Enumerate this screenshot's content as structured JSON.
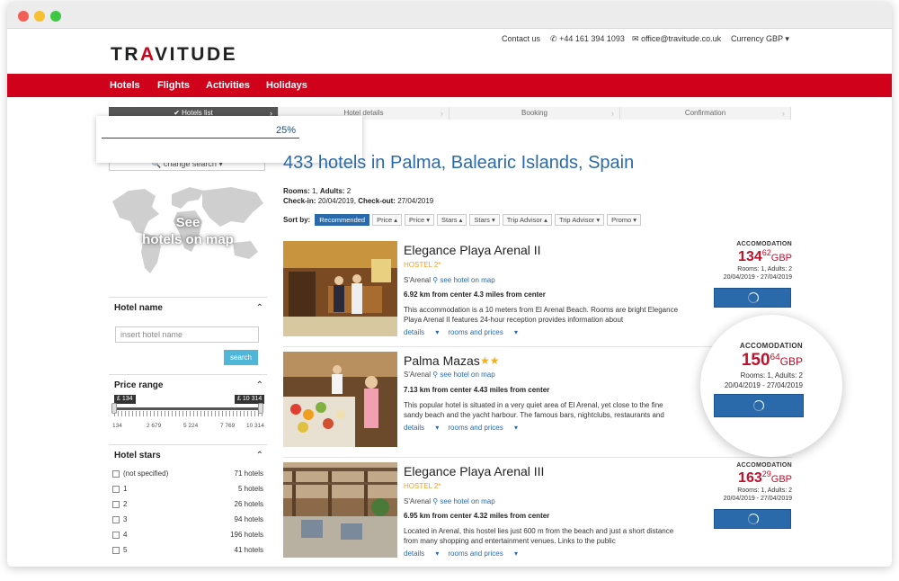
{
  "topbar": {
    "contact": "Contact us",
    "phone": "+44 161 394 1093",
    "email": "office@travitude.co.uk",
    "currency": "Currency GBP"
  },
  "brand": {
    "logo_pre": "TR",
    "logo_a": "A",
    "logo_post": "VITUDE"
  },
  "nav": [
    "Hotels",
    "Flights",
    "Activities",
    "Holidays"
  ],
  "steps": [
    "Hotels list",
    "Hotel details",
    "Booking",
    "Confirmation"
  ],
  "progress": {
    "percent_label": "25%",
    "value": 0.25
  },
  "change_search": "change search",
  "results": {
    "title": "433 hotels in Palma, Balearic Islands, Spain",
    "rooms_label": "Rooms:",
    "rooms": "1,",
    "adults_label": "Adults:",
    "adults": "2",
    "checkin_label": "Check-in:",
    "checkin": "20/04/2019,",
    "checkout_label": "Check-out:",
    "checkout": "27/04/2019"
  },
  "sort": {
    "label": "Sort by:",
    "buttons": [
      "Recommended",
      "Price",
      "Price",
      "Stars",
      "Stars",
      "Trip Advisor",
      "Trip Advisor",
      "Promo"
    ]
  },
  "map": {
    "line1": "See",
    "line2": "hotels on map"
  },
  "hotel_name_filter": {
    "title": "Hotel name",
    "placeholder": "insert hotel name",
    "button": "search"
  },
  "price_range": {
    "title": "Price range",
    "min_tag": "£ 134",
    "max_tag": "£ 10 314",
    "ticks": [
      "134",
      "2 679",
      "5 224",
      "7 769",
      "10 314"
    ]
  },
  "hotel_stars": {
    "title": "Hotel stars",
    "rows": [
      {
        "label": "(not specified)",
        "count": "71 hotels"
      },
      {
        "label": "1",
        "count": "5 hotels"
      },
      {
        "label": "2",
        "count": "26 hotels"
      },
      {
        "label": "3",
        "count": "94 hotels"
      },
      {
        "label": "4",
        "count": "196 hotels"
      },
      {
        "label": "5",
        "count": "41 hotels"
      }
    ]
  },
  "hotels": [
    {
      "name": "Elegance Playa Arenal II",
      "type": "HOSTEL 2*",
      "stars": "",
      "town": "S'Arenal",
      "map_link": "see hotel on map",
      "distance": "6.92 km from center 4.3 miles from center",
      "desc": "This accommodation is a 10 meters from El Arenal Beach. Rooms are bright Elegance Playa Arenal II features 24-hour reception provides information about",
      "details": "details",
      "rooms_prices": "rooms and prices",
      "acc": "ACCOMODATION",
      "price_int": "134",
      "price_dec": "62",
      "currency": "GBP",
      "rooms_adults": "Rooms: 1, Adults: 2",
      "dates": "20/04/2019 - 27/04/2019"
    },
    {
      "name": "Palma Mazas",
      "type": "",
      "stars": "★★",
      "town": "S'Arenal",
      "map_link": "see hotel on map",
      "distance": "7.13 km from center 4.43 miles from center",
      "desc": "This popular hotel is situated in a very quiet area of El Arenal, yet close to the fine sandy beach and the yacht harbour. The famous bars, nightclubs, restaurants and",
      "details": "details",
      "rooms_prices": "rooms and prices",
      "acc": "ACCOMODATION",
      "price_int": "150",
      "price_dec": "64",
      "currency": "GBP",
      "rooms_adults": "Rooms: 1, Adults: 2",
      "dates": "20/04/2019 - 27/04/2019"
    },
    {
      "name": "Elegance Playa Arenal III",
      "type": "HOSTEL 2*",
      "stars": "",
      "town": "S'Arenal",
      "map_link": "see hotel on map",
      "distance": "6.95 km from center 4.32 miles from center",
      "desc": "Located in Arenal, this hostel lies just 600 m from the beach and just a short distance from many shopping and entertainment venues. Links to the public",
      "details": "details",
      "rooms_prices": "rooms and prices",
      "acc": "ACCOMODATION",
      "price_int": "163",
      "price_dec": "29",
      "currency": "GBP",
      "rooms_adults": "Rooms: 1, Adults: 2",
      "dates": "20/04/2019 - 27/04/2019"
    }
  ],
  "colors": {
    "brand_red": "#d0021b",
    "link_blue": "#2a6aaa",
    "price_red": "#c0102a",
    "accent_cyan": "#4fb6d8"
  }
}
